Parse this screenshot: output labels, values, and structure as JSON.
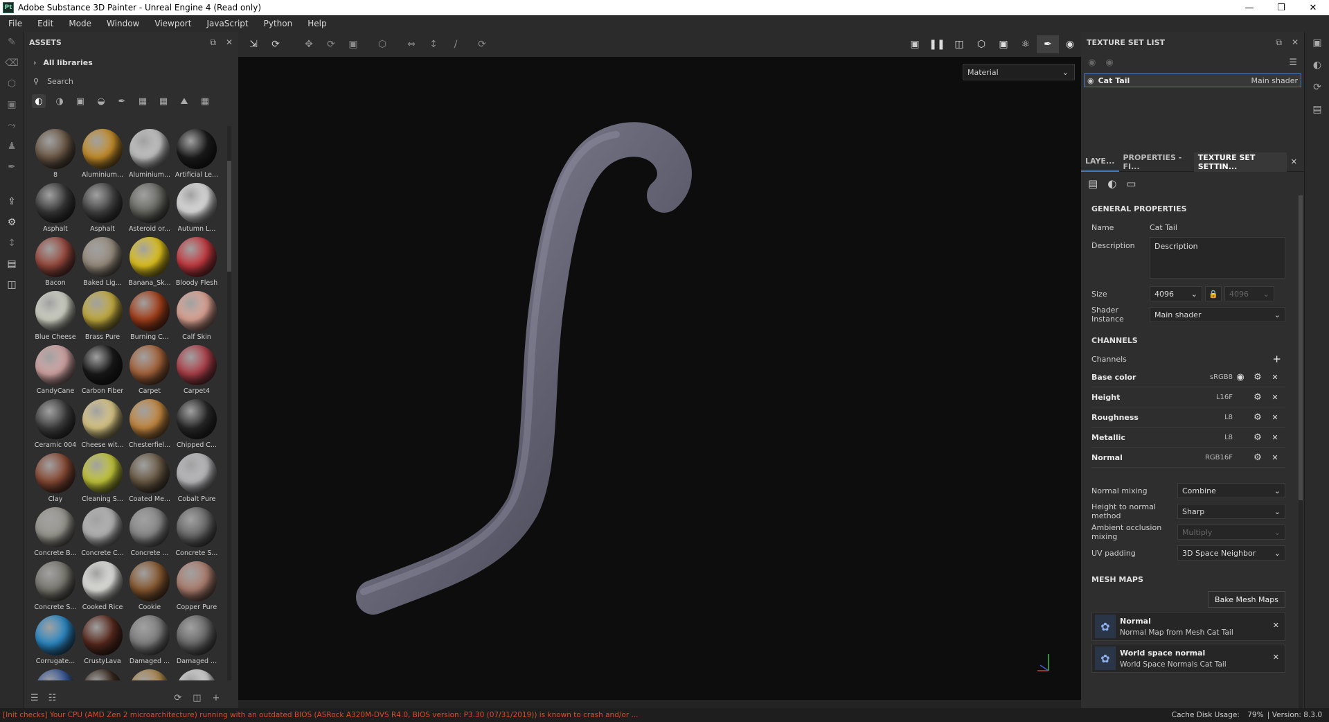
{
  "window": {
    "title": "Adobe Substance 3D Painter - Unreal Engine 4 (Read only)",
    "app_icon": "Pt"
  },
  "menu": [
    "File",
    "Edit",
    "Mode",
    "Window",
    "Viewport",
    "JavaScript",
    "Python",
    "Help"
  ],
  "assets": {
    "title": "ASSETS",
    "library": "All libraries",
    "search_placeholder": "Search",
    "items": [
      {
        "label": "8",
        "color": "#6e5a48"
      },
      {
        "label": "Aluminium...",
        "color": "#c9902a"
      },
      {
        "label": "Aluminium...",
        "color": "#c8c8c8"
      },
      {
        "label": "Artificial Le...",
        "color": "#1c1c1c"
      },
      {
        "label": "Asphalt",
        "color": "#3a3a3a"
      },
      {
        "label": "Asphalt",
        "color": "#454545"
      },
      {
        "label": "Asteroid or...",
        "color": "#6a6a64"
      },
      {
        "label": "Autumn L...",
        "color": "#e4e4e4"
      },
      {
        "label": "Bacon",
        "color": "#9b4a3e"
      },
      {
        "label": "Baked Lig...",
        "color": "#9a8e80"
      },
      {
        "label": "Banana_Sk...",
        "color": "#e6c81e"
      },
      {
        "label": "Bloody Flesh",
        "color": "#c83a40"
      },
      {
        "label": "Blue Cheese",
        "color": "#d6d8ca"
      },
      {
        "label": "Brass Pure",
        "color": "#c8b040"
      },
      {
        "label": "Burning C...",
        "color": "#a8401a"
      },
      {
        "label": "Calf Skin",
        "color": "#e4a898"
      },
      {
        "label": "CandyCane",
        "color": "#d8a8a8"
      },
      {
        "label": "Carbon Fiber",
        "color": "#1a1a1a"
      },
      {
        "label": "Carpet",
        "color": "#a8643a"
      },
      {
        "label": "Carpet4",
        "color": "#b0404a"
      },
      {
        "label": "Ceramic 004",
        "color": "#404040"
      },
      {
        "label": "Cheese wit...",
        "color": "#e0cc88"
      },
      {
        "label": "Chesterfiel...",
        "color": "#c88a40"
      },
      {
        "label": "Chipped C...",
        "color": "#2a2a2a"
      },
      {
        "label": "Clay",
        "color": "#8a4a34"
      },
      {
        "label": "Cleaning S...",
        "color": "#c8cc3a"
      },
      {
        "label": "Coated Me...",
        "color": "#6a5a44"
      },
      {
        "label": "Cobalt Pure",
        "color": "#c0c0c4"
      },
      {
        "label": "Concrete B...",
        "color": "#9a9890"
      },
      {
        "label": "Concrete C...",
        "color": "#b8b8b8"
      },
      {
        "label": "Concrete ...",
        "color": "#8a8a8a"
      },
      {
        "label": "Concrete S...",
        "color": "#6a6a6a"
      },
      {
        "label": "Concrete S...",
        "color": "#7a7870"
      },
      {
        "label": "Cooked Rice",
        "color": "#e8e8e4"
      },
      {
        "label": "Cookie",
        "color": "#8a5a30"
      },
      {
        "label": "Copper Pure",
        "color": "#b08070"
      },
      {
        "label": "Corrugate...",
        "color": "#2a8ac8"
      },
      {
        "label": "CrustyLava",
        "color": "#5a2a1e"
      },
      {
        "label": "Damaged ...",
        "color": "#808080"
      },
      {
        "label": "Damaged ...",
        "color": "#6a6a6a"
      },
      {
        "label": "",
        "color": "#3a5a9a"
      },
      {
        "label": "",
        "color": "#3a2a20"
      },
      {
        "label": "",
        "color": "#b08a50"
      },
      {
        "label": "",
        "color": "#d8d8d8"
      }
    ]
  },
  "viewport": {
    "display_mode": "Material"
  },
  "texture_set_list": {
    "title": "TEXTURE SET LIST",
    "set_name": "Cat Tail",
    "shader": "Main shader"
  },
  "tabs": [
    "LAYE...",
    "PROPERTIES - FI...",
    "TEXTURE SET SETTIN..."
  ],
  "texture_set_settings": {
    "general_title": "GENERAL PROPERTIES",
    "name_label": "Name",
    "name_value": "Cat Tail",
    "description_label": "Description",
    "description_value": "Description",
    "size_label": "Size",
    "size_value": "4096",
    "size_linked": "4096",
    "shader_instance_label": "Shader Instance",
    "shader_instance_value": "Main shader",
    "channels_title": "CHANNELS",
    "channels_label": "Channels",
    "channels": [
      {
        "name": "Base color",
        "format": "sRGB8"
      },
      {
        "name": "Height",
        "format": "L16F"
      },
      {
        "name": "Roughness",
        "format": "L8"
      },
      {
        "name": "Metallic",
        "format": "L8"
      },
      {
        "name": "Normal",
        "format": "RGB16F"
      }
    ],
    "normal_mixing_label": "Normal mixing",
    "normal_mixing_value": "Combine",
    "height_to_normal_label": "Height to normal method",
    "height_to_normal_value": "Sharp",
    "ao_mixing_label": "Ambient occlusion mixing",
    "ao_mixing_value": "Multiply",
    "uv_padding_label": "UV padding",
    "uv_padding_value": "3D Space Neighbor",
    "mesh_maps_title": "MESH MAPS",
    "bake_button": "Bake Mesh Maps",
    "mesh_maps": [
      {
        "title": "Normal",
        "subtitle": "Normal Map from Mesh Cat Tail"
      },
      {
        "title": "World space normal",
        "subtitle": "World Space Normals Cat Tail"
      }
    ]
  },
  "status": {
    "message": "[Init checks] Your CPU (AMD Zen 2 microarchitecture) running with an outdated BIOS (ASRock A320M-DVS R4.0, BIOS version: P3.30 (07/31/2019)) is known to crash and/or ...",
    "cache": "Cache Disk Usage:",
    "cache_pct": "79%",
    "version": "| Version: 8.3.0"
  }
}
